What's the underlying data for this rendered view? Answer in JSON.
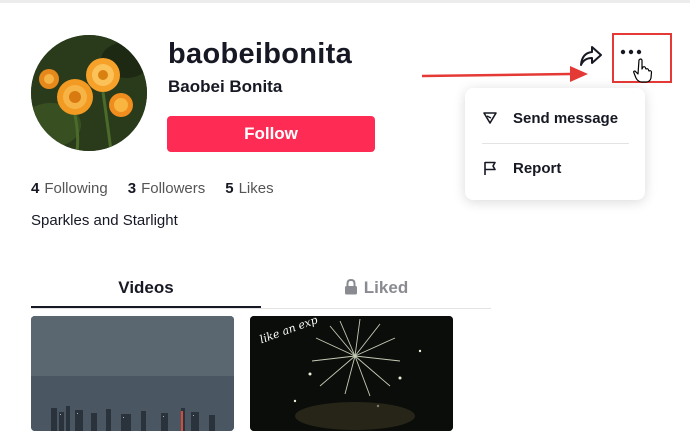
{
  "profile": {
    "username": "baobeibonita",
    "nickname": "Baobei Bonita",
    "follow_label": "Follow",
    "bio": "Sparkles and Starlight"
  },
  "stats": [
    {
      "count": "4",
      "label": "Following"
    },
    {
      "count": "3",
      "label": "Followers"
    },
    {
      "count": "5",
      "label": "Likes"
    }
  ],
  "menu": {
    "items": [
      {
        "label": "Send message",
        "icon": "send-icon"
      },
      {
        "label": "Report",
        "icon": "flag-icon"
      }
    ]
  },
  "tabs": [
    {
      "label": "Videos",
      "active": true
    },
    {
      "label": "Liked",
      "locked": true
    }
  ],
  "videos": [
    {
      "overlay_text": ""
    },
    {
      "overlay_text": "like an exp"
    }
  ],
  "colors": {
    "accent": "#fe2c55",
    "highlight_box": "#e53935"
  }
}
